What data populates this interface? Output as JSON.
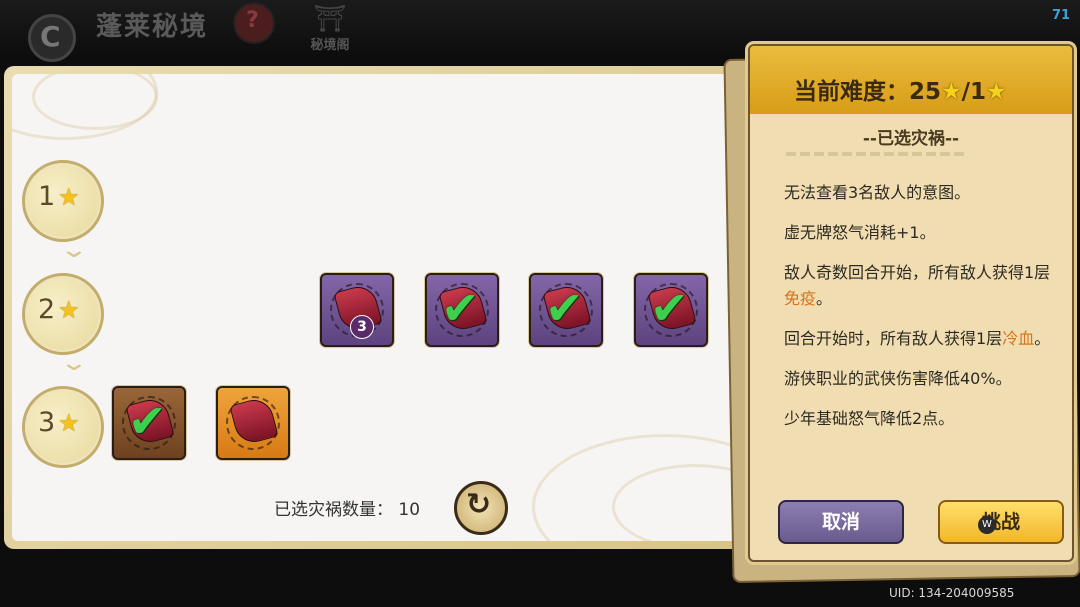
{
  "top_bar": {
    "back_glyph": "C",
    "title": "蓬莱秘境",
    "badge_glyph": "?",
    "pavilion_label": "秘境阁",
    "fps": "71"
  },
  "tiers": [
    {
      "label": "1",
      "star": "★"
    },
    {
      "label": "2",
      "star": "★"
    },
    {
      "label": "3",
      "star": "★"
    }
  ],
  "cards": [
    {
      "tier": 2,
      "color": "purple",
      "checked": false,
      "count": "3"
    },
    {
      "tier": 2,
      "color": "purple",
      "checked": true,
      "count": ""
    },
    {
      "tier": 2,
      "color": "purple",
      "checked": true,
      "count": ""
    },
    {
      "tier": 2,
      "color": "purple",
      "checked": true,
      "count": ""
    },
    {
      "tier": 3,
      "color": "brown",
      "checked": true,
      "count": ""
    },
    {
      "tier": 3,
      "color": "orange",
      "checked": false,
      "count": ""
    }
  ],
  "footer": {
    "selected_count_label": "已选灾祸数量：",
    "selected_count_value": "10",
    "refresh_icon": "↻"
  },
  "right_panel": {
    "difficulty_label": "当前难度：",
    "difficulty_value": "25",
    "difficulty_sep": "/1",
    "star": "★",
    "section_title": "--已选灾祸--",
    "curses": [
      {
        "text": "无法查看3名敌人的意图。",
        "highlight": ""
      },
      {
        "text": "虚无牌怒气消耗+1。",
        "highlight": ""
      },
      {
        "text": "敌人奇数回合开始，所有敌人获得1层",
        "highlight": "免疫",
        "tail": "。"
      },
      {
        "text": "回合开始时，所有敌人获得1层",
        "highlight": "冷血",
        "tail": "。"
      },
      {
        "text": "游侠职业的武侠伤害降低40%。",
        "highlight": ""
      },
      {
        "text": "少年基础怒气降低2点。",
        "highlight": ""
      }
    ],
    "cancel_label": "取消",
    "challenge_label": "挑战",
    "hotkey": "W"
  },
  "uid": "UID: 134-204009585",
  "colors": {
    "accent_gold": "#f2b62a",
    "highlight_orange": "#d97418",
    "check_green": "#3fcf4f",
    "card_purple": "#6f53a0",
    "card_brown": "#86552c",
    "card_orange": "#e8901f"
  }
}
